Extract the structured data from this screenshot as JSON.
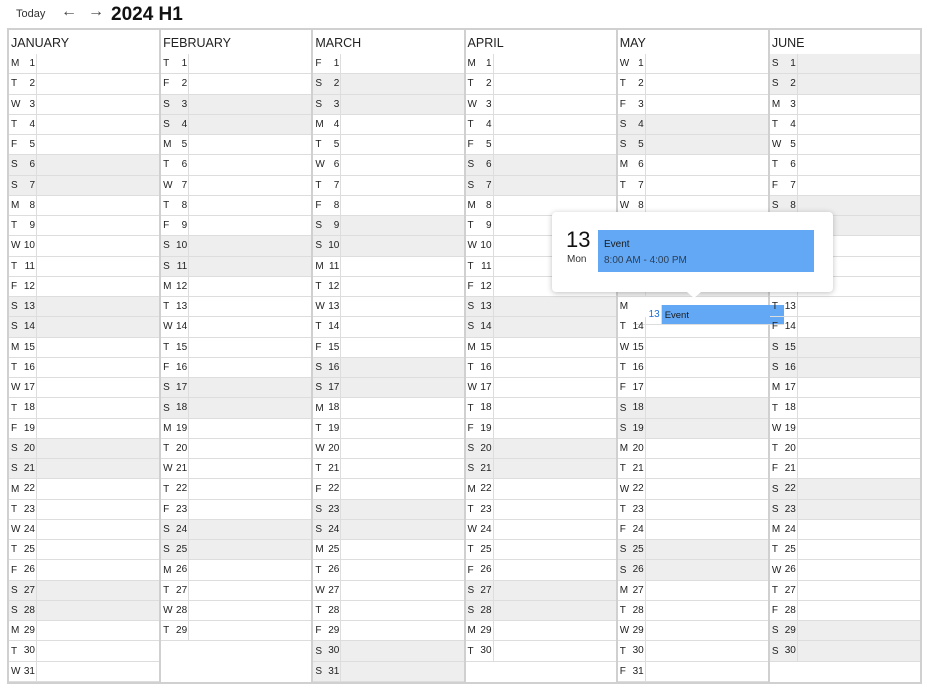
{
  "toolbar": {
    "today_label": "Today",
    "prev_icon": "arrow-left-icon",
    "next_icon": "arrow-right-icon",
    "title": "2024 H1",
    "prev_glyph": "←",
    "next_glyph": "→"
  },
  "months": [
    {
      "name": "JANUARY",
      "weekdays": "MTWTFSSMTWTFSSMTWTFSSMTWTFSSMTW"
    },
    {
      "name": "FEBRUARY",
      "weekdays": "TFSSMTWTFSSMTWTFSSMTWTFSSMTWT"
    },
    {
      "name": "MARCH",
      "weekdays": "FSSMTWTFSSMTWTFSSMTWTFSSMTWTFSS"
    },
    {
      "name": "APRIL",
      "weekdays": "MTWTFSSMTWTFSSMTWTFSSMTWTFSSMT"
    },
    {
      "name": "MAY",
      "weekdays": "WTFSSMTWTFSSMTWTFSSMTWTFSSMTWTF"
    },
    {
      "name": "JUNE",
      "weekdays": "SSMTWTFSSMTWTFSSMTWTFSSMTWTFSS"
    }
  ],
  "today": {
    "month": 4,
    "day": 13
  },
  "events": [
    {
      "month": 4,
      "day": 13,
      "title": "Event"
    }
  ],
  "popup": {
    "day": "13",
    "weekday": "Mon",
    "event_title": "Event",
    "event_time": "8:00 AM - 4:00 PM"
  },
  "colors": {
    "weekend": "#eeeeee",
    "event": "#62a8f5",
    "today": "#1a6fd6"
  }
}
